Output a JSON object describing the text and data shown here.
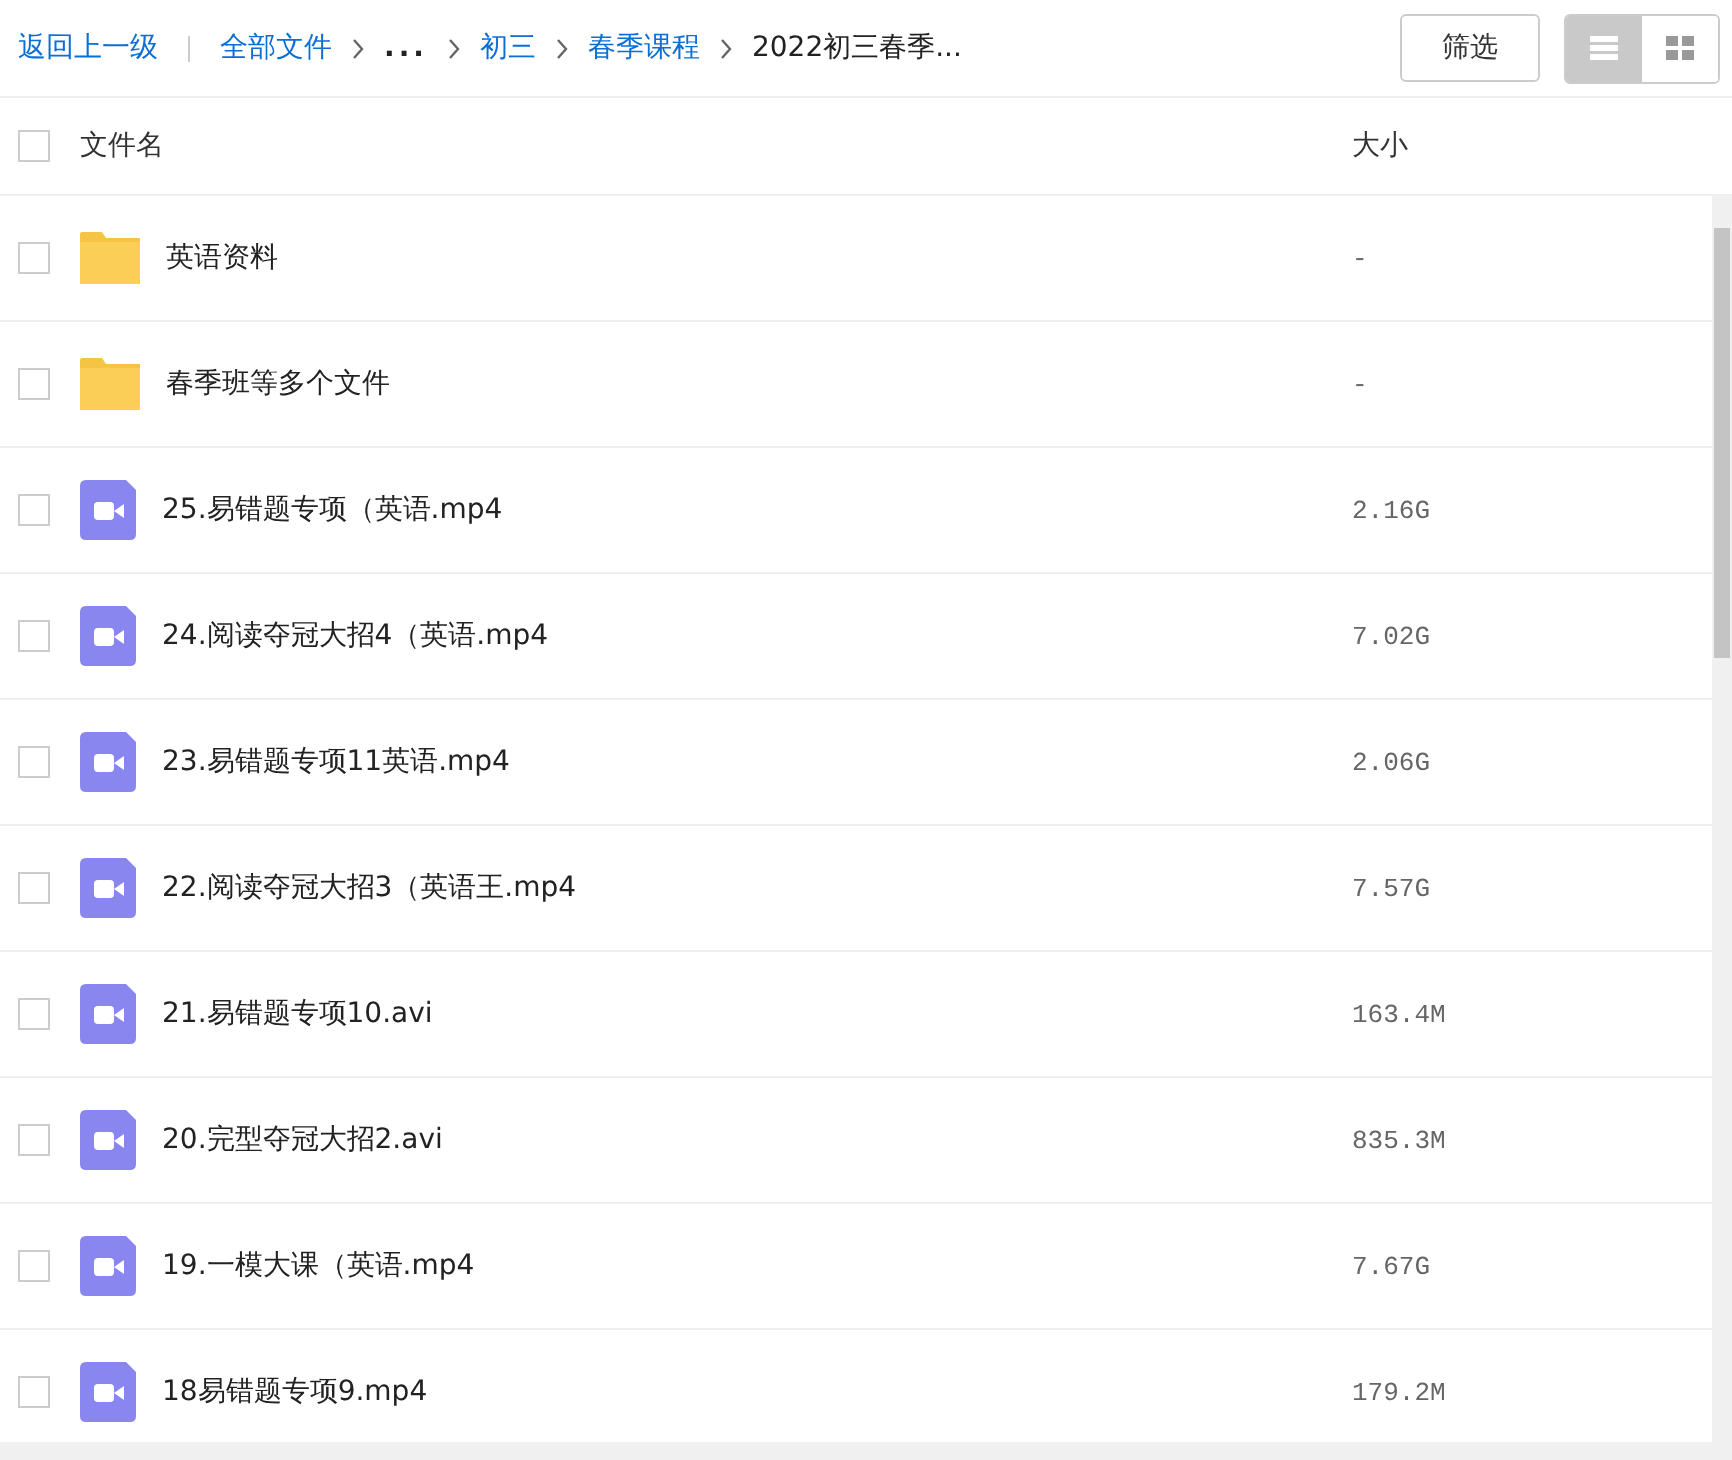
{
  "toolbar": {
    "back_link": "返回上一级",
    "breadcrumb": [
      {
        "kind": "link",
        "label": "全部文件"
      },
      {
        "kind": "ellipsis",
        "label": "..."
      },
      {
        "kind": "link",
        "label": "初三"
      },
      {
        "kind": "link",
        "label": "春季课程"
      },
      {
        "kind": "current",
        "label": "2022初三春季..."
      }
    ],
    "filter_button": "筛选",
    "view_modes": [
      {
        "kind": "list",
        "selected": true
      },
      {
        "kind": "grid",
        "selected": false
      }
    ]
  },
  "table": {
    "select_all_checked": false,
    "columns": [
      "文件名",
      "大小"
    ],
    "rows": [
      {
        "kind": "folder",
        "name": "英语资料",
        "size": "-",
        "checked": false
      },
      {
        "kind": "folder",
        "name": "春季班等多个文件",
        "size": "-",
        "checked": false
      },
      {
        "kind": "video",
        "name": "25.易错题专项（英语.mp4",
        "size": "2.16G",
        "checked": false
      },
      {
        "kind": "video",
        "name": "24.阅读夺冠大招4（英语.mp4",
        "size": "7.02G",
        "checked": false
      },
      {
        "kind": "video",
        "name": "23.易错题专项11英语.mp4",
        "size": "2.06G",
        "checked": false
      },
      {
        "kind": "video",
        "name": "22.阅读夺冠大招3（英语王.mp4",
        "size": "7.57G",
        "checked": false
      },
      {
        "kind": "video",
        "name": "21.易错题专项10.avi",
        "size": "163.4M",
        "checked": false
      },
      {
        "kind": "video",
        "name": "20.完型夺冠大招2.avi",
        "size": "835.3M",
        "checked": false
      },
      {
        "kind": "video",
        "name": "19.一模大课（英语.mp4",
        "size": "7.67G",
        "checked": false
      },
      {
        "kind": "video",
        "name": "18易错题专项9.mp4",
        "size": "179.2M",
        "checked": false
      }
    ]
  }
}
